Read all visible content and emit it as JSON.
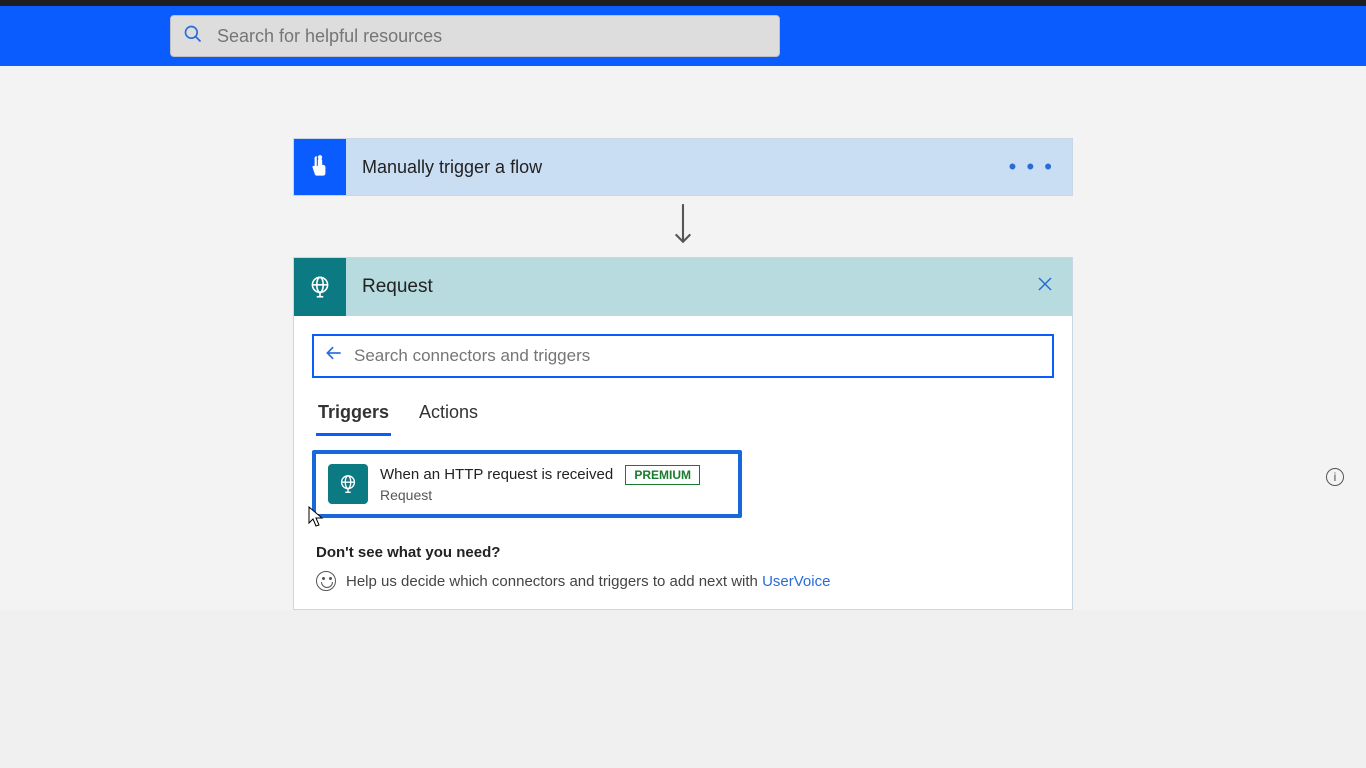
{
  "header": {
    "search_placeholder": "Search for helpful resources"
  },
  "trigger": {
    "title": "Manually trigger a flow",
    "more": "• • •"
  },
  "panel": {
    "title": "Request",
    "search_placeholder": "Search connectors and triggers",
    "tabs": {
      "triggers": "Triggers",
      "actions": "Actions"
    },
    "result": {
      "title": "When an HTTP request is received",
      "subtitle": "Request",
      "badge": "PREMIUM"
    },
    "need": {
      "question": "Don't see what you need?",
      "help_prefix": "Help us decide which connectors and triggers to add next with ",
      "link_text": "UserVoice"
    }
  }
}
